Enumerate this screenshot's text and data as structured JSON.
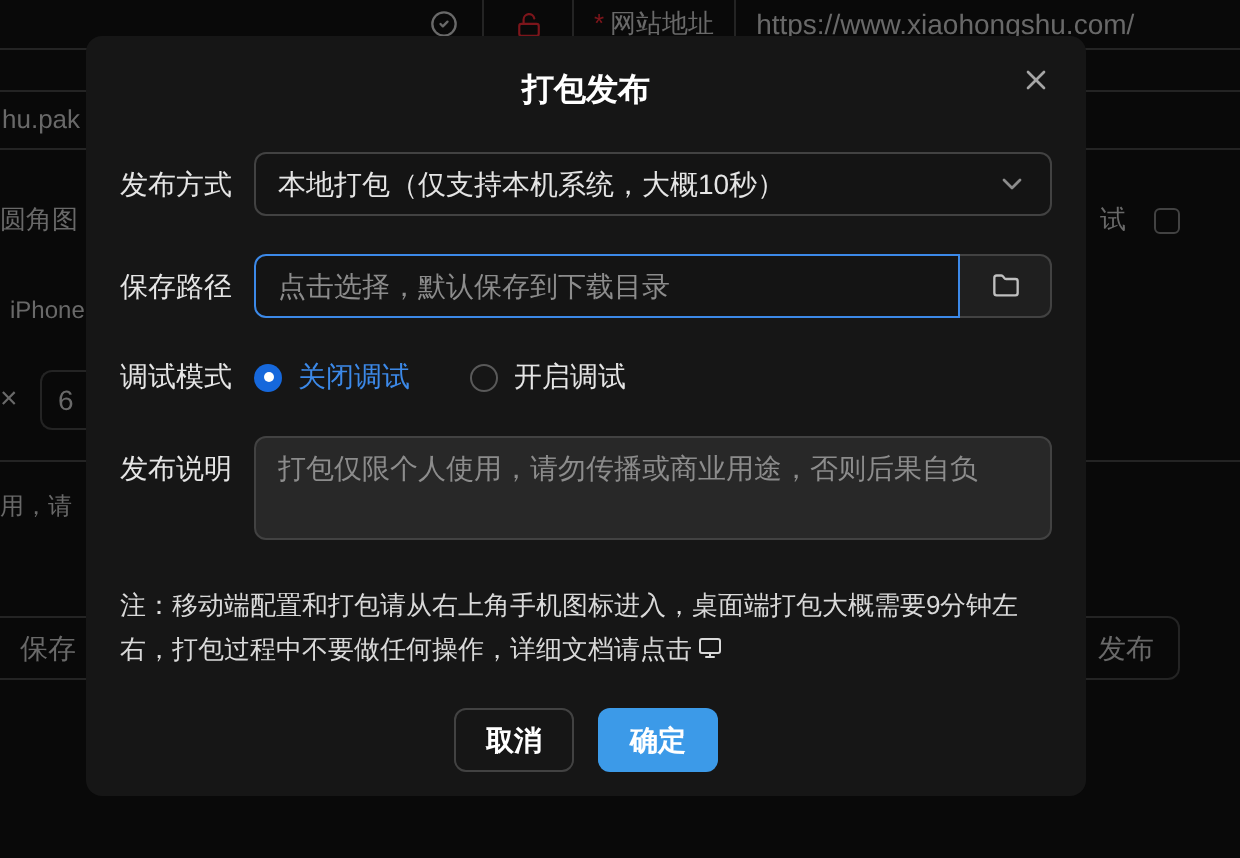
{
  "background": {
    "url_label": {
      "required_mark": "*",
      "text": "网站地址"
    },
    "url_value": "https://www.xiaohongshu.com/",
    "name_field": "hu.pak",
    "icon_option": "圆角图",
    "debug_option": {
      "label": "试",
      "checked": false
    },
    "device_label": "iPhone",
    "size_separator": "×",
    "size_field": "6",
    "hint": "用，请",
    "save_button": "保存",
    "publish_button": "发布"
  },
  "dialog": {
    "title": "打包发布",
    "fields": [
      {
        "kind": "select",
        "label": "发布方式",
        "value": "本地打包（仅支持本机系统，大概10秒）"
      },
      {
        "kind": "path",
        "label": "保存路径",
        "placeholder": "点击选择，默认保存到下载目录",
        "focused": true
      },
      {
        "kind": "radio",
        "label": "调试模式",
        "options": [
          {
            "label": "关闭调试",
            "selected": true
          },
          {
            "label": "开启调试",
            "selected": false
          }
        ]
      },
      {
        "kind": "textarea",
        "label": "发布说明",
        "placeholder": "打包仅限个人使用，请勿传播或商业用途，否则后果自负"
      }
    ],
    "note": "注：移动端配置和打包请从右上角手机图标进入，桌面端打包大概需要9分钟左右，打包过程中不要做任何操作，详细文档请点击",
    "buttons": [
      {
        "kind": "default",
        "label": "取消"
      },
      {
        "kind": "primary",
        "label": "确定"
      }
    ]
  }
}
